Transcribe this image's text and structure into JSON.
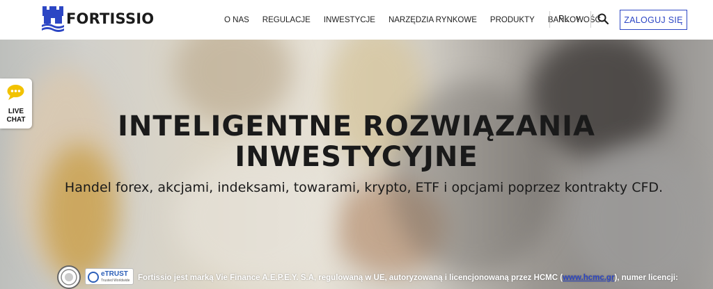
{
  "brand": {
    "name": "FORTISSIO"
  },
  "nav": {
    "items": [
      {
        "label": "O NAS"
      },
      {
        "label": "REGULACJE"
      },
      {
        "label": "INWESTYCJE"
      },
      {
        "label": "NARZĘDZIA RYNKOWE"
      },
      {
        "label": "PRODUKTY"
      },
      {
        "label": "BANKOWOŚĆ"
      }
    ],
    "language": "PL",
    "language_chevron": "v",
    "login_label": "ZALOGUJ SIĘ"
  },
  "livechat": {
    "line1": "LIVE",
    "line2": "CHAT"
  },
  "hero": {
    "title_line1": "INTELIGENTNE ROZWIĄZANIA",
    "title_line2": "INWESTYCYJNE",
    "subtitle": "Handel forex, akcjami, indeksami, towarami, krypto, ETF i opcjami poprzez kontrakty CFD."
  },
  "regulation": {
    "badge_text": "eTRUST",
    "badge_sub": "Trusted Worldwide",
    "text_before": "Fortissio jest marką Vie Finance A.E.P.E.Y. S.A, regulowaną w UE, autoryzowaną i licencjonowaną przez HCMC (",
    "link": "www.hcmc.gr",
    "text_after": "), numer licencji:"
  },
  "colors": {
    "accent": "#2c46c4",
    "text": "#1a1a1a",
    "chat_yellow": "#f2c200"
  },
  "icons": [
    "castle-logo-icon",
    "search-icon",
    "chat-bubble-icon",
    "seal-icon",
    "check-icon"
  ]
}
